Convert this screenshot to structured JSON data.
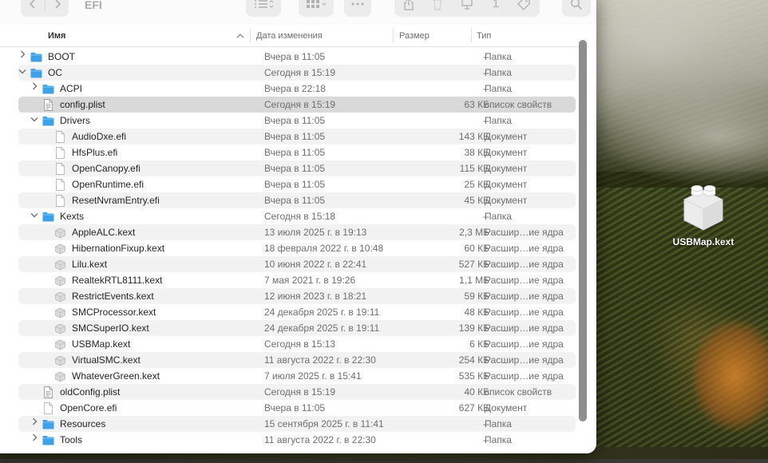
{
  "window": {
    "title": "EFI"
  },
  "toolbar": {
    "back_icon": "chevron-left-icon",
    "forward_icon": "chevron-right-icon",
    "view_list_icon": "list-view-icon",
    "view_grid_icon": "grid-view-icon",
    "more_icon": "ellipsis-icon",
    "share_icon": "share-icon",
    "trash_icon": "trash-icon",
    "desktop_icon": "desktop-icon",
    "count_label": "1",
    "tag_icon": "tag-icon",
    "search_icon": "search-icon"
  },
  "columns": {
    "name": "Имя",
    "date": "Дата изменения",
    "size": "Размер",
    "kind": "Тип"
  },
  "rows": [
    {
      "name": "BOOT",
      "date": "Вчера в 11:05",
      "size": "--",
      "kind": "Папка",
      "type": "folder",
      "level": 0,
      "disclosure": "›",
      "alt": false,
      "selected": false
    },
    {
      "name": "OC",
      "date": "Сегодня в 15:19",
      "size": "--",
      "kind": "Папка",
      "type": "folder",
      "level": 0,
      "disclosure": "⌄",
      "alt": true,
      "selected": false
    },
    {
      "name": "ACPI",
      "date": "Вчера в 22:18",
      "size": "--",
      "kind": "Папка",
      "type": "folder",
      "level": 1,
      "disclosure": "›",
      "alt": false,
      "selected": false
    },
    {
      "name": "config.plist",
      "date": "Сегодня в 15:19",
      "size": "63 КБ",
      "kind": "список свойств",
      "type": "plist",
      "level": 1,
      "disclosure": "",
      "alt": true,
      "selected": true
    },
    {
      "name": "Drivers",
      "date": "Вчера в 11:05",
      "size": "--",
      "kind": "Папка",
      "type": "folder",
      "level": 1,
      "disclosure": "⌄",
      "alt": false,
      "selected": false
    },
    {
      "name": "AudioDxe.efi",
      "date": "Вчера в 11:05",
      "size": "143 КБ",
      "kind": "Документ",
      "type": "file",
      "level": 2,
      "disclosure": "",
      "alt": true,
      "selected": false
    },
    {
      "name": "HfsPlus.efi",
      "date": "Вчера в 11:05",
      "size": "38 КБ",
      "kind": "Документ",
      "type": "file",
      "level": 2,
      "disclosure": "",
      "alt": false,
      "selected": false
    },
    {
      "name": "OpenCanopy.efi",
      "date": "Вчера в 11:05",
      "size": "115 КБ",
      "kind": "Документ",
      "type": "file",
      "level": 2,
      "disclosure": "",
      "alt": true,
      "selected": false
    },
    {
      "name": "OpenRuntime.efi",
      "date": "Вчера в 11:05",
      "size": "25 КБ",
      "kind": "Документ",
      "type": "file",
      "level": 2,
      "disclosure": "",
      "alt": false,
      "selected": false
    },
    {
      "name": "ResetNvramEntry.efi",
      "date": "Вчера в 11:05",
      "size": "45 КБ",
      "kind": "Документ",
      "type": "file",
      "level": 2,
      "disclosure": "",
      "alt": true,
      "selected": false
    },
    {
      "name": "Kexts",
      "date": "Сегодня в 15:18",
      "size": "--",
      "kind": "Папка",
      "type": "folder",
      "level": 1,
      "disclosure": "⌄",
      "alt": false,
      "selected": false
    },
    {
      "name": "AppleALC.kext",
      "date": "13 июля 2025 г. в 19:13",
      "size": "2,3 МБ",
      "kind": "Расшир…ие ядра",
      "type": "kext",
      "level": 2,
      "disclosure": "",
      "alt": true,
      "selected": false
    },
    {
      "name": "HibernationFixup.kext",
      "date": "18 февраля 2022 г. в 10:48",
      "size": "60 КБ",
      "kind": "Расшир…ие ядра",
      "type": "kext",
      "level": 2,
      "disclosure": "",
      "alt": false,
      "selected": false
    },
    {
      "name": "Lilu.kext",
      "date": "10 июня 2022 г. в 22:41",
      "size": "527 КБ",
      "kind": "Расшир…ие ядра",
      "type": "kext",
      "level": 2,
      "disclosure": "",
      "alt": true,
      "selected": false
    },
    {
      "name": "RealtekRTL8111.kext",
      "date": "7 мая 2021 г. в 19:26",
      "size": "1,1 МБ",
      "kind": "Расшир…ие ядра",
      "type": "kext",
      "level": 2,
      "disclosure": "",
      "alt": false,
      "selected": false
    },
    {
      "name": "RestrictEvents.kext",
      "date": "12 июня 2023 г. в 18:21",
      "size": "59 КБ",
      "kind": "Расшир…ие ядра",
      "type": "kext",
      "level": 2,
      "disclosure": "",
      "alt": true,
      "selected": false
    },
    {
      "name": "SMCProcessor.kext",
      "date": "24 декабря 2025 г. в 19:11",
      "size": "48 КБ",
      "kind": "Расшир…ие ядра",
      "type": "kext",
      "level": 2,
      "disclosure": "",
      "alt": false,
      "selected": false
    },
    {
      "name": "SMCSuperIO.kext",
      "date": "24 декабря 2025 г. в 19:11",
      "size": "139 КБ",
      "kind": "Расшир…ие ядра",
      "type": "kext",
      "level": 2,
      "disclosure": "",
      "alt": true,
      "selected": false
    },
    {
      "name": "USBMap.kext",
      "date": "Сегодня в 15:13",
      "size": "6 КБ",
      "kind": "Расшир…ие ядра",
      "type": "kext",
      "level": 2,
      "disclosure": "",
      "alt": false,
      "selected": false
    },
    {
      "name": "VirtualSMC.kext",
      "date": "11 августа 2022 г. в 22:30",
      "size": "254 КБ",
      "kind": "Расшир…ие ядра",
      "type": "kext",
      "level": 2,
      "disclosure": "",
      "alt": true,
      "selected": false
    },
    {
      "name": "WhateverGreen.kext",
      "date": "7 июля 2025 г. в 15:41",
      "size": "535 КБ",
      "kind": "Расшир…ие ядра",
      "type": "kext",
      "level": 2,
      "disclosure": "",
      "alt": false,
      "selected": false
    },
    {
      "name": "oldConfig.plist",
      "date": "Сегодня в 15:19",
      "size": "40 КБ",
      "kind": "список свойств",
      "type": "plist",
      "level": 1,
      "disclosure": "",
      "alt": true,
      "selected": false
    },
    {
      "name": "OpenCore.efi",
      "date": "Вчера в 11:05",
      "size": "627 КБ",
      "kind": "Документ",
      "type": "file",
      "level": 1,
      "disclosure": "",
      "alt": false,
      "selected": false
    },
    {
      "name": "Resources",
      "date": "15 сентября 2025 г. в 11:41",
      "size": "--",
      "kind": "Папка",
      "type": "folder",
      "level": 1,
      "disclosure": "›",
      "alt": true,
      "selected": false
    },
    {
      "name": "Tools",
      "date": "11 августа 2022 г. в 22:30",
      "size": "--",
      "kind": "Папка",
      "type": "folder",
      "level": 1,
      "disclosure": "›",
      "alt": false,
      "selected": false
    }
  ],
  "desktop": {
    "file_label": "USBMap.kext",
    "file_icon": "kext-bundle-icon"
  },
  "colors": {
    "folder": "#3fa0e8",
    "selected_row": "#d9d9d9",
    "alt_row": "#f2f2f2"
  }
}
